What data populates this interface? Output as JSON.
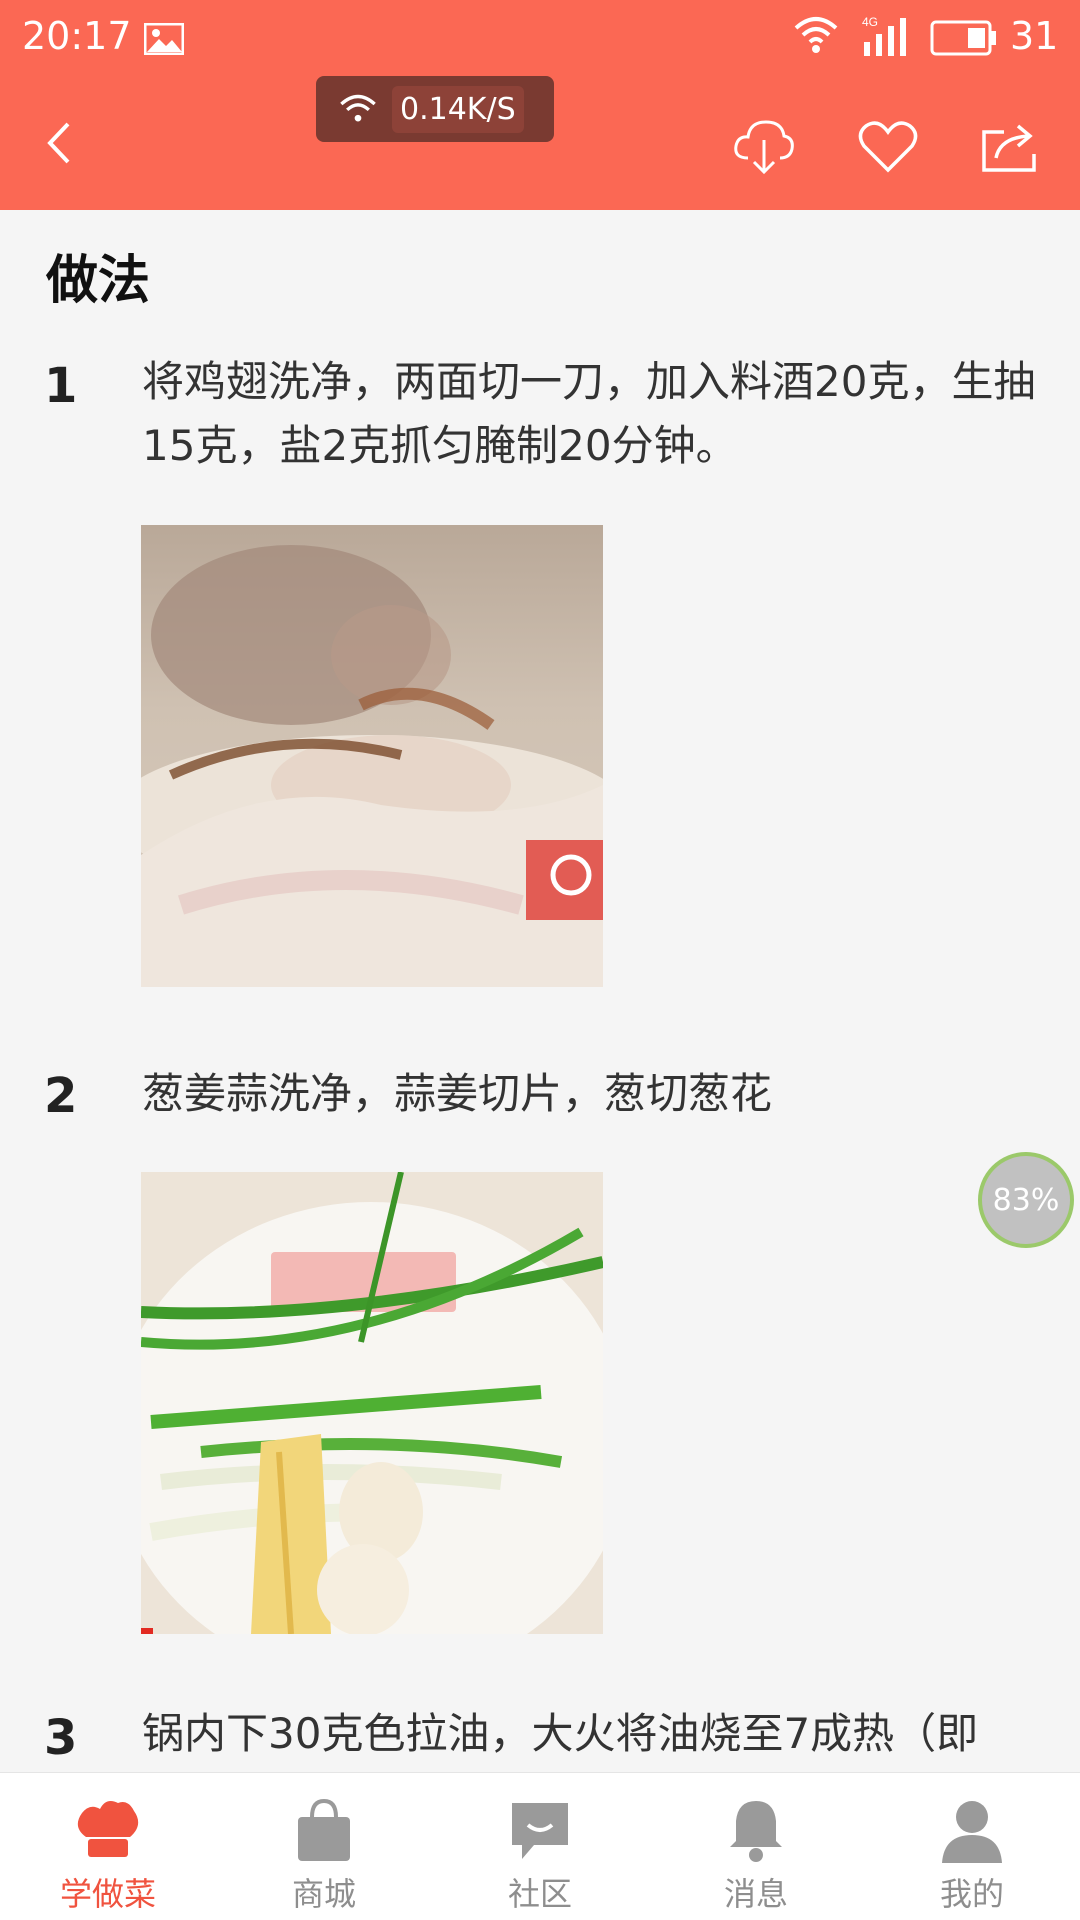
{
  "status_bar": {
    "time": "20:17",
    "network_type": "4G",
    "battery_level": "31"
  },
  "header": {
    "speed": "0.14K/S",
    "colors": {
      "accent": "#fb6854"
    }
  },
  "content": {
    "section_title": "做法",
    "steps": [
      {
        "number": "1",
        "text": "将鸡翅洗净，两面切一刀，加入料酒20克，生抽15克，盐2克抓匀腌制20分钟。",
        "image_watermark": ""
      },
      {
        "number": "2",
        "text": "葱姜蒜洗净，蒜姜切片，葱切葱花",
        "image_watermark": ""
      },
      {
        "number": "3",
        "text": "锅内下30克色拉油，大火将油烧至7成热（即"
      }
    ]
  },
  "floating_progress": "83%",
  "tabbar": {
    "tabs": [
      {
        "label": "学做菜",
        "icon": "chef-hat-icon",
        "active": true
      },
      {
        "label": "商城",
        "icon": "shopping-bag-icon",
        "active": false
      },
      {
        "label": "社区",
        "icon": "chat-bubble-icon",
        "active": false
      },
      {
        "label": "消息",
        "icon": "bell-icon",
        "active": false
      },
      {
        "label": "我的",
        "icon": "person-icon",
        "active": false
      }
    ]
  }
}
